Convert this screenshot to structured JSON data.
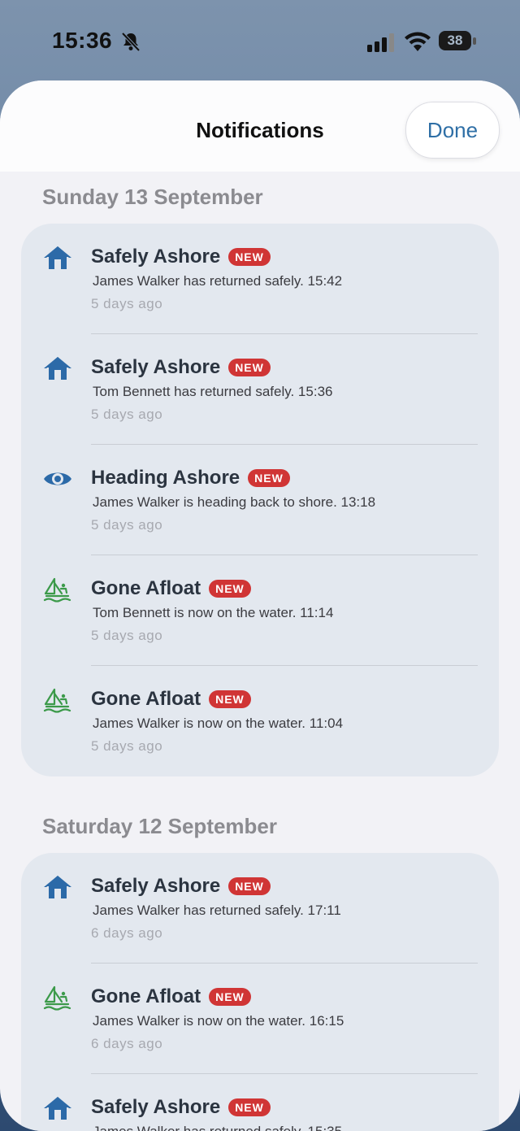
{
  "status_bar": {
    "time": "15:36",
    "battery": "38"
  },
  "sheet": {
    "title": "Notifications",
    "done_label": "Done"
  },
  "sections": [
    {
      "title": "Sunday 13 September",
      "items": [
        {
          "icon": "house-icon",
          "title": "Safely Ashore",
          "badge": "NEW",
          "message": "James Walker has returned safely. 15:42",
          "ago": "5 days ago"
        },
        {
          "icon": "house-icon",
          "title": "Safely Ashore",
          "badge": "NEW",
          "message": "Tom Bennett has returned safely. 15:36",
          "ago": "5 days ago"
        },
        {
          "icon": "eye-icon",
          "title": "Heading Ashore",
          "badge": "NEW",
          "message": "James Walker is heading back to shore. 13:18",
          "ago": "5 days ago"
        },
        {
          "icon": "sailing-icon",
          "title": "Gone Afloat",
          "badge": "NEW",
          "message": "Tom Bennett is now on the water. 11:14",
          "ago": "5 days ago"
        },
        {
          "icon": "sailing-icon",
          "title": "Gone Afloat",
          "badge": "NEW",
          "message": "James Walker is now on the water. 11:04",
          "ago": "5 days ago"
        }
      ]
    },
    {
      "title": "Saturday 12 September",
      "items": [
        {
          "icon": "house-icon",
          "title": "Safely Ashore",
          "badge": "NEW",
          "message": "James Walker has returned safely. 17:11",
          "ago": "6 days ago"
        },
        {
          "icon": "sailing-icon",
          "title": "Gone Afloat",
          "badge": "NEW",
          "message": "James Walker is now on the water. 16:15",
          "ago": "6 days ago"
        },
        {
          "icon": "house-icon",
          "title": "Safely Ashore",
          "badge": "NEW",
          "message": "James Walker has returned safely. 15:35",
          "ago": ""
        }
      ]
    }
  ],
  "colors": {
    "accent": "#2f6fa6",
    "house_icon": "#2c6aa8",
    "eye_icon": "#2c6aa8",
    "sailing_icon": "#3c9a4a",
    "badge": "#d03535",
    "card": "#e3e8ef",
    "sheet": "#f2f2f6"
  }
}
